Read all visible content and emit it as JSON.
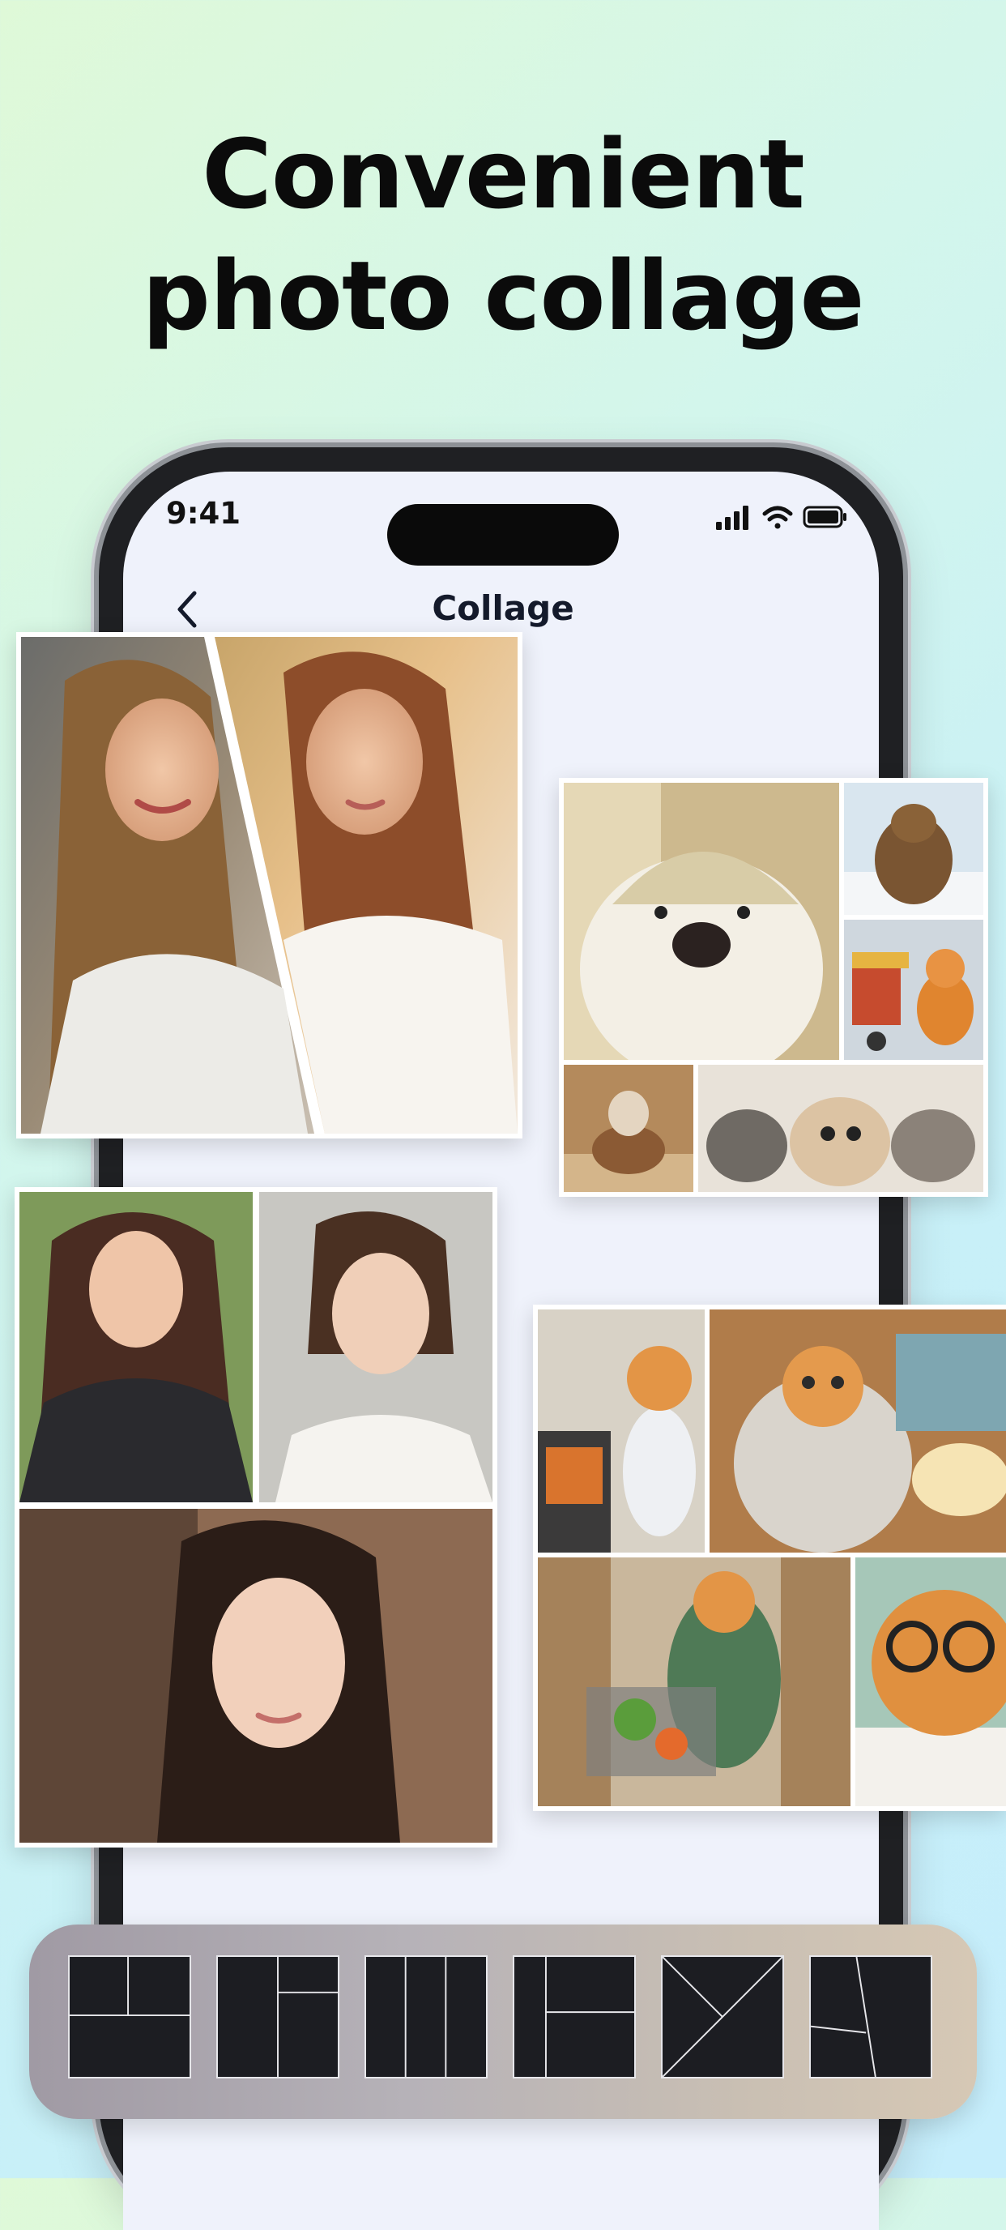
{
  "headline": {
    "line1": "Convenient",
    "line2": "photo collage"
  },
  "status_bar": {
    "time": "9:41",
    "icons": [
      "cellular-signal-icon",
      "wifi-icon",
      "battery-icon"
    ]
  },
  "nav": {
    "back_icon": "chevron-left-icon",
    "title": "Collage"
  },
  "collages": [
    {
      "id": "collage-portraits-diagonal",
      "tiles": [
        "portrait-long-hair-smiling",
        "portrait-sunlit-girl"
      ]
    },
    {
      "id": "collage-pets",
      "tiles": [
        "dog-in-hat",
        "bear-on-snow",
        "cat-with-cart",
        "cat-riding-pony",
        "group-of-cats"
      ]
    },
    {
      "id": "collage-portraits-grid",
      "tiles": [
        "portrait-lace-dress",
        "portrait-updo",
        "portrait-dark-hair"
      ]
    },
    {
      "id": "collage-cats",
      "tiles": [
        "cat-baking",
        "cat-in-bathrobe-popcorn",
        "cat-shopping",
        "cat-with-glasses"
      ]
    }
  ],
  "layout_picker": {
    "options": [
      "layout-grid-option",
      "layout-split-option",
      "layout-columns-option",
      "layout-stack-option",
      "layout-diagonal-option",
      "layout-angled-option"
    ]
  }
}
